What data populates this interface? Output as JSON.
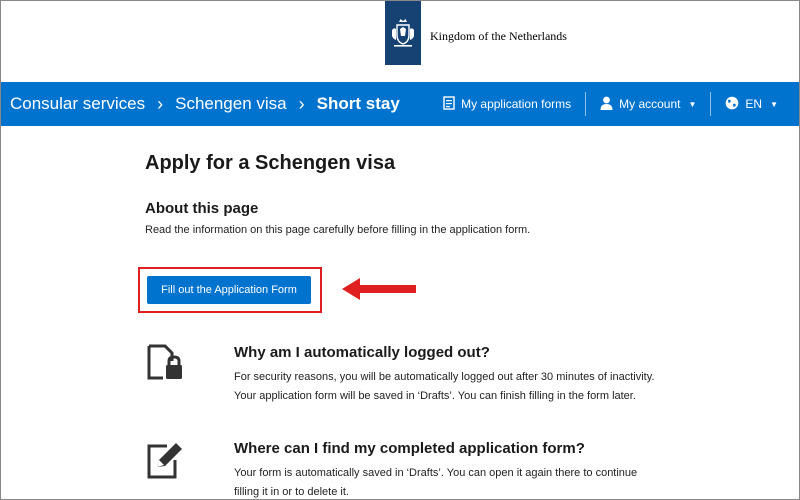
{
  "header": {
    "logo_text": "Kingdom of the Netherlands",
    "emblem_icon": "coat-of-arms-icon"
  },
  "nav": {
    "breadcrumbs": [
      "Consular services",
      "Schengen visa",
      "Short stay"
    ],
    "my_forms_label": "My application forms",
    "my_account_label": "My account",
    "language_label": "EN",
    "colors": {
      "bar": "#0073cf"
    }
  },
  "main": {
    "title": "Apply for a Schengen visa",
    "about_heading": "About this page",
    "about_text": "Read the information on this page carefully before filling in the application form.",
    "cta_label": "Fill out the Application Form",
    "highlight_color": "#e02020"
  },
  "faqs": [
    {
      "icon": "lock-document-icon",
      "title": "Why am I automatically logged out?",
      "body": "For security reasons, you will be automatically logged out after 30 minutes of inactivity. Your application form will be saved in ‘Drafts’. You can finish filling in the form later."
    },
    {
      "icon": "edit-document-icon",
      "title": "Where can I find my completed application form?",
      "body": "Your form is automatically saved in ‘Drafts’. You can open it again there to continue filling it in or to delete it."
    }
  ]
}
